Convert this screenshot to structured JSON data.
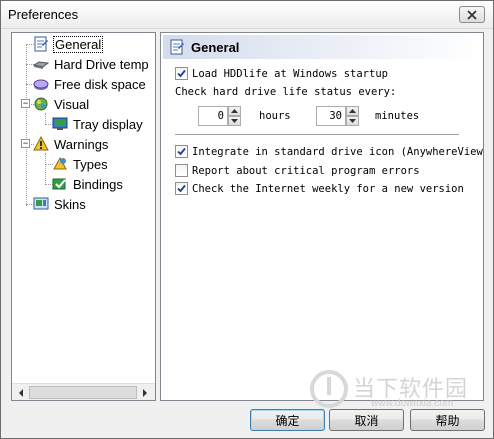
{
  "window": {
    "title": "Preferences"
  },
  "tree": {
    "items": [
      {
        "label": "General",
        "icon": "general-icon"
      },
      {
        "label": "Hard Drive temp",
        "icon": "hard-drive-icon"
      },
      {
        "label": "Free disk space",
        "icon": "disk-space-icon"
      },
      {
        "label": "Visual",
        "icon": "visual-icon"
      },
      {
        "label": "Tray display",
        "icon": "tray-display-icon"
      },
      {
        "label": "Warnings",
        "icon": "warnings-icon"
      },
      {
        "label": "Types",
        "icon": "types-icon"
      },
      {
        "label": "Bindings",
        "icon": "bindings-icon"
      },
      {
        "label": "Skins",
        "icon": "skins-icon"
      }
    ],
    "selected": "General"
  },
  "panel": {
    "title": "General",
    "load_at_startup": {
      "label": "Load HDDlife at Windows startup",
      "checked": true
    },
    "check_status_label": "Check hard drive life status every:",
    "hours": {
      "value": "0",
      "unit": "hours"
    },
    "minutes": {
      "value": "30",
      "unit": "minutes"
    },
    "integrate_icon": {
      "label": "Integrate in standard drive icon (AnywhereView",
      "checked": true
    },
    "report_errors": {
      "label": "Report about critical program errors",
      "checked": false
    },
    "check_internet": {
      "label": "Check the Internet weekly for a new version",
      "checked": true
    }
  },
  "buttons": {
    "ok": "确定",
    "cancel": "取消",
    "help": "帮助"
  },
  "watermark": {
    "text": "当下软件园",
    "url": "www.downxia.com"
  },
  "colors": {
    "check": "#1c3f8f",
    "header_gradient": "#d4dcec"
  }
}
